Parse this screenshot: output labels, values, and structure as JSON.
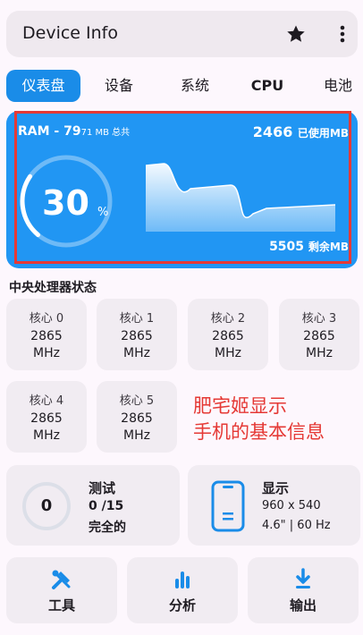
{
  "app_bar": {
    "title": "Device Info",
    "star_icon": "star-icon",
    "more_icon": "more-vert-icon"
  },
  "tabs": [
    {
      "label": "仪表盘",
      "active": true
    },
    {
      "label": "设备"
    },
    {
      "label": "系统"
    },
    {
      "label": "CPU"
    },
    {
      "label": "电池"
    }
  ],
  "ram": {
    "title_prefix": "RAM - 79",
    "title_small": "71 MB 总共",
    "used_value": "2466",
    "used_label": "已使用MB",
    "percent": "30",
    "percent_sign": "%",
    "free_value": "5505",
    "free_label": "剩余MB",
    "usage_fraction": 0.3,
    "colors": {
      "card": "#2196f3",
      "highlight_border": "#e53935"
    }
  },
  "cpu_section": {
    "title": "中央处理器状态",
    "cores": [
      {
        "label": "核心 0",
        "freq": "2865",
        "unit": "MHz"
      },
      {
        "label": "核心 1",
        "freq": "2865",
        "unit": "MHz"
      },
      {
        "label": "核心 2",
        "freq": "2865",
        "unit": "MHz"
      },
      {
        "label": "核心 3",
        "freq": "2865",
        "unit": "MHz"
      },
      {
        "label": "核心 4",
        "freq": "2865",
        "unit": "MHz"
      },
      {
        "label": "核心 5",
        "freq": "2865",
        "unit": "MHz"
      }
    ]
  },
  "annotation": {
    "line1": "肥宅姬显示",
    "line2": "手机的基本信息",
    "color": "#e53935"
  },
  "tests": {
    "count": "0",
    "title": "测试",
    "score": "0 /15",
    "status": "完全的"
  },
  "display": {
    "title": "显示",
    "resolution": "960 x 540",
    "size_refresh": "4.6\" | 60 Hz",
    "icon": "phone-icon"
  },
  "bottom_actions": [
    {
      "label": "工具",
      "icon": "tools-icon"
    },
    {
      "label": "分析",
      "icon": "bar-chart-icon"
    },
    {
      "label": "输出",
      "icon": "download-icon"
    }
  ],
  "accent_color": "#1a8ce8"
}
